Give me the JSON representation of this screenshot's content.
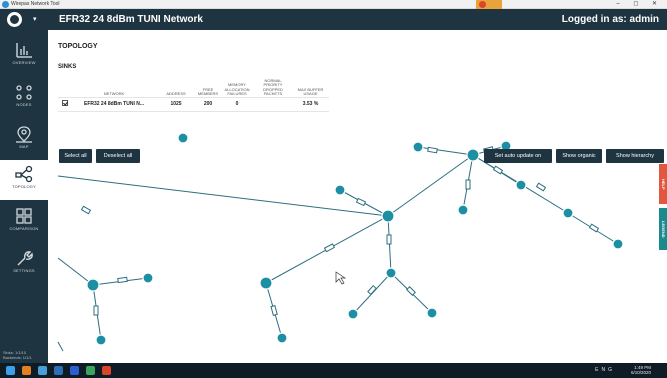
{
  "window": {
    "title": "Wirepas Network Tool",
    "buttons": "–  ◻  ✕"
  },
  "header": {
    "network_name": "EFR32 24 8dBm TUNI Network",
    "logged_in": "Logged in as: admin",
    "logo_caret": "▾"
  },
  "sidebar": {
    "items": [
      {
        "label": "OVERVIEW",
        "icon": "bar-chart-icon",
        "active": false
      },
      {
        "label": "NODES",
        "icon": "nodes-icon",
        "active": false
      },
      {
        "label": "MAP",
        "icon": "map-icon",
        "active": false
      },
      {
        "label": "TOPOLOGY",
        "icon": "topology-icon",
        "active": true
      },
      {
        "label": "COMPARISON",
        "icon": "comparison-grid-icon",
        "active": false
      },
      {
        "label": "SETTINGS",
        "icon": "wrench-icon",
        "active": false
      }
    ],
    "footer": [
      "Sinks: 1/1/10",
      "Backends: 1/1/1"
    ]
  },
  "main": {
    "page_title": "TOPOLOGY",
    "section_title": "SINKS",
    "table": {
      "headers": [
        "",
        "NETWORK",
        "ADDRESS",
        "FREE MEMBERS",
        "MEMORY ALLOCATION FAILURES",
        "NORMAL PRIORITY DROPPED PACKETS",
        "MAX BUFFER USAGE"
      ],
      "row": {
        "checked": true,
        "network": "EFR32 24 8dBm TUNI N...",
        "address": "1025",
        "free_members": "200",
        "memory_failures": "0",
        "dropped": "",
        "buffer": "3.53 %"
      }
    },
    "buttons": {
      "select_all": "Select all",
      "deselect_all": "Deselect all",
      "auto_update": "Set auto update on",
      "organic": "Show organic",
      "hierarchy": "Show hierarchy"
    },
    "side_tabs": {
      "help": "HELP",
      "legend": "LEGEND"
    }
  },
  "taskbar": {
    "time": "1:49 PM",
    "date": "6/10/2020",
    "lang": "ENG"
  },
  "colors": {
    "accent": "#1e3440",
    "node_fill": "#1d8fa3",
    "link": "#2c6e80",
    "help_tab": "#e2583e",
    "legend_tab": "#1a8a8f"
  }
}
